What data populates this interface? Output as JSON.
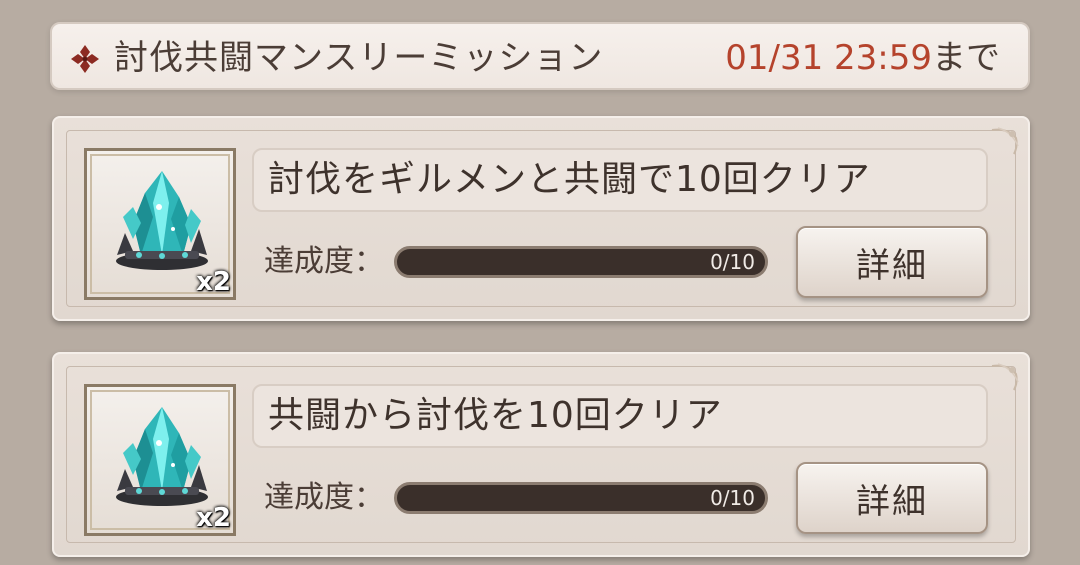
{
  "header": {
    "title": "討伐共闘マンスリーミッション",
    "deadline_date": "01/31 23:59",
    "deadline_suffix": "まで",
    "icon": "diamond-cross-icon"
  },
  "colors": {
    "deadline": "#b5432c",
    "text": "#4b3d36",
    "progress_track": "#3a2f2a"
  },
  "missions": [
    {
      "title": "討伐をギルメンと共闘で10回クリア",
      "progress_label": "達成度：",
      "progress_text": "0/10",
      "progress_value": 0,
      "progress_max": 10,
      "reward_icon": "teal-crystal-icon",
      "reward_qty": "x2",
      "detail_label": "詳細"
    },
    {
      "title": "共闘から討伐を10回クリア",
      "progress_label": "達成度：",
      "progress_text": "0/10",
      "progress_value": 0,
      "progress_max": 10,
      "reward_icon": "teal-crystal-icon",
      "reward_qty": "x2",
      "detail_label": "詳細"
    }
  ]
}
